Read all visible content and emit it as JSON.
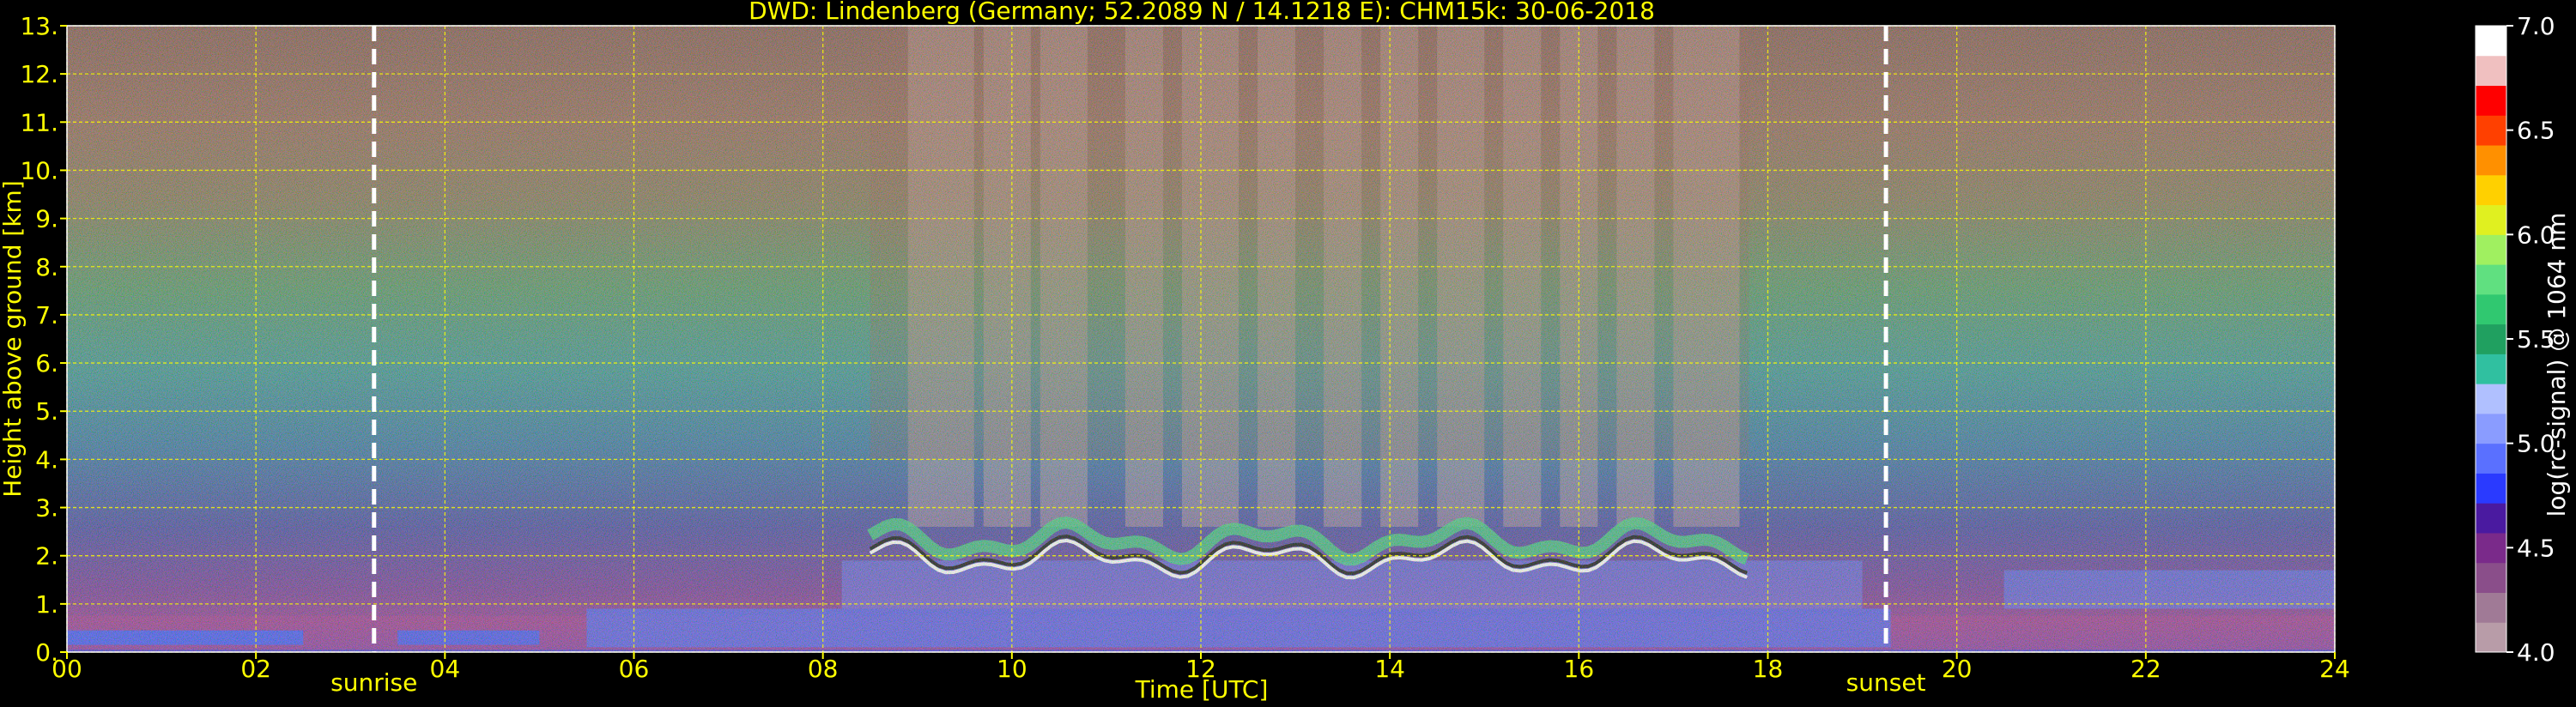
{
  "chart_data": {
    "type": "heatmap",
    "title": "DWD: Lindenberg (Germany; 52.2089 N / 14.1218 E):    CHM15k: 30-06-2018",
    "xlabel": "Time [UTC]",
    "ylabel": "Height above ground [km]",
    "xlim": [
      0,
      24
    ],
    "ylim": [
      0,
      13
    ],
    "xticks": [
      0,
      2,
      4,
      6,
      8,
      10,
      12,
      14,
      16,
      18,
      20,
      22,
      24
    ],
    "xtick_labels": [
      "00",
      "02",
      "04",
      "06",
      "08",
      "10",
      "12",
      "14",
      "16",
      "18",
      "20",
      "22",
      "24"
    ],
    "yticks": [
      0,
      1,
      2,
      3,
      4,
      5,
      6,
      7,
      8,
      9,
      10,
      11,
      12,
      13
    ],
    "ytick_labels": [
      "0.",
      "1.",
      "2.",
      "3.",
      "4.",
      "5.",
      "6.",
      "7.",
      "8.",
      "9.",
      "10.",
      "11.",
      "12.",
      "13."
    ],
    "grid": true,
    "grid_color": "#ffff00",
    "axis_text_color": "#ffff00",
    "annotations": [
      {
        "label": "sunrise",
        "x": 3.25
      },
      {
        "label": "sunset",
        "x": 19.25
      }
    ],
    "colorbar": {
      "label": "log(rc-signal) @ 1064 nm",
      "range": [
        4.0,
        7.0
      ],
      "ticks": [
        4.0,
        4.5,
        5.0,
        5.5,
        6.0,
        6.5,
        7.0
      ],
      "tick_labels": [
        "4.0",
        "4.5",
        "5.0",
        "5.5",
        "6.0",
        "6.5",
        "7.0"
      ],
      "colors": [
        "#b89ca8",
        "#a07a96",
        "#8a4e8a",
        "#7a2a8a",
        "#4a1aa0",
        "#2a3aff",
        "#5a70ff",
        "#8a9cff",
        "#b0c0ff",
        "#30c0a0",
        "#20a060",
        "#30c870",
        "#60e080",
        "#a0f060",
        "#e0f020",
        "#ffd000",
        "#ff9000",
        "#ff4000",
        "#ff0000",
        "#f0c0c0",
        "#ffffff"
      ]
    },
    "features": {
      "boundary_layer_top_km": 0.7,
      "cloud_layer_km": [
        1.8,
        2.6
      ],
      "cloud_time_range": [
        8.5,
        17.8
      ]
    }
  }
}
